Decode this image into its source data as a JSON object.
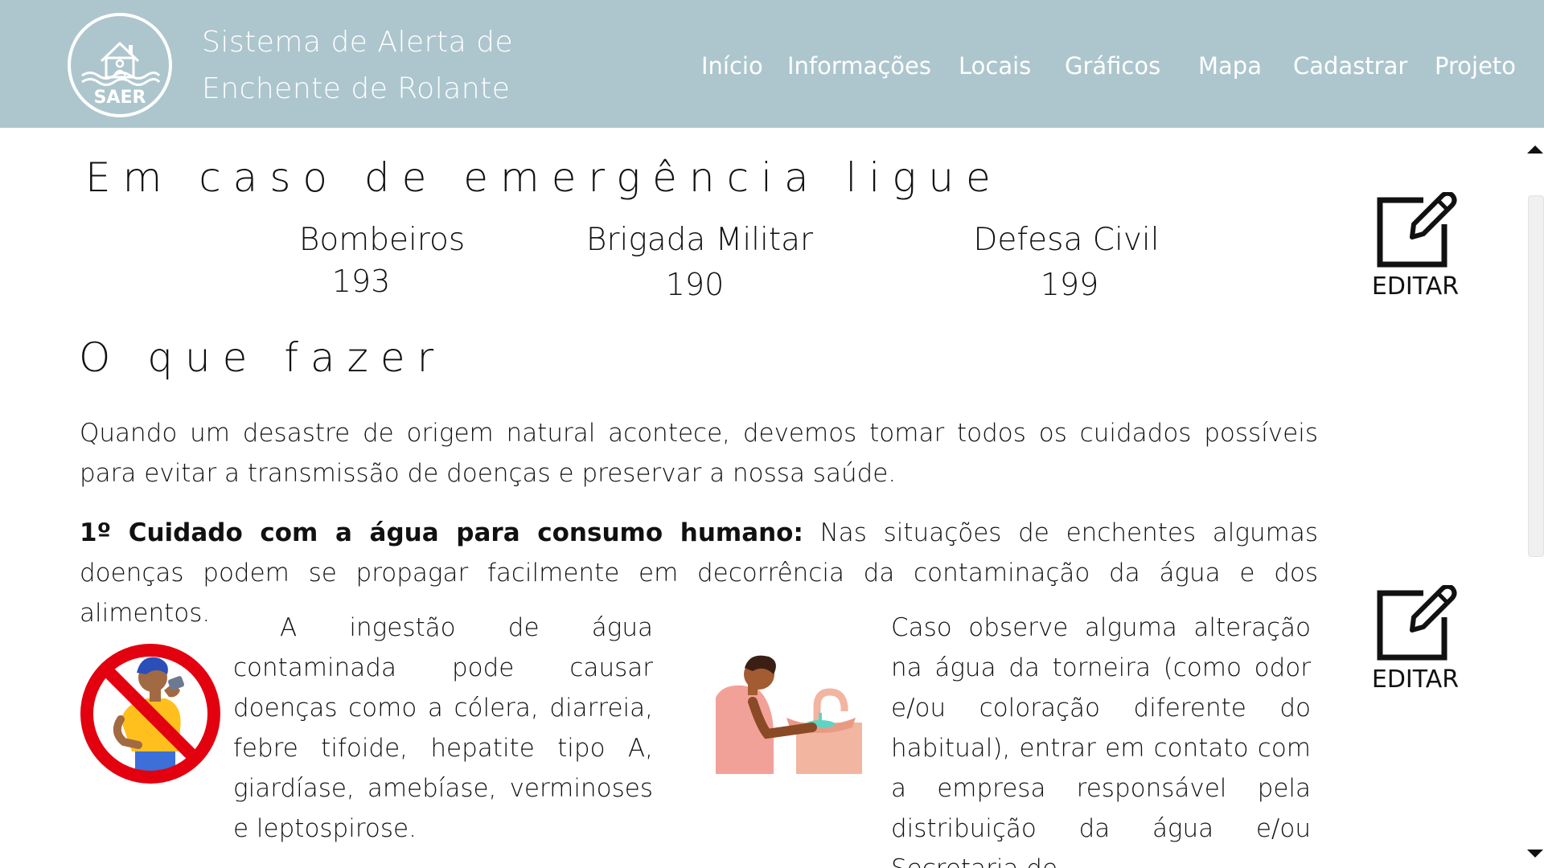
{
  "header": {
    "logo_text": "SAER",
    "title_line1": "Sistema de Alerta de",
    "title_line2": "Enchente de Rolante",
    "nav": [
      {
        "label": "Início"
      },
      {
        "label": "Informações"
      },
      {
        "label": "Locais"
      },
      {
        "label": "Gráficos"
      },
      {
        "label": "Mapa"
      },
      {
        "label": "Cadastrar"
      },
      {
        "label": "Projeto"
      }
    ],
    "bg_color": "#adc6ce"
  },
  "emergency": {
    "heading": "Em caso de emergência ligue",
    "contacts": [
      {
        "name": "Bombeiros",
        "number": "193"
      },
      {
        "name": "Brigada Militar",
        "number": "190"
      },
      {
        "name": "Defesa Civil",
        "number": "199"
      }
    ]
  },
  "what_to_do": {
    "heading": "O que fazer",
    "intro": "Quando um desastre de origem natural acontece, devemos tomar todos os cuidados possíveis para evitar a transmissão de doenças e preservar a nossa saúde.",
    "care1_title": "1º Cuidado com a água para consumo humano:",
    "care1_text": " Nas situações de enchentes algumas doenças podem se propagar facilmente em decorrência da contaminação da água e dos alimentos.",
    "left_column": "A ingestão de água contaminada pode causar doenças como a cólera, diarreia, febre tifoide, hepatite tipo A, giardíase, amebíase, verminoses e leptospirose.",
    "right_column": "Caso observe alguma alteração na água da torneira (como odor e/ou coloração diferente do habitual), entrar em contato com a empresa responsável pela distribuição da água e/ou Secretaria de"
  },
  "edit_buttons": [
    {
      "label": "EDITAR",
      "icon": "edit-icon"
    },
    {
      "label": "EDITAR",
      "icon": "edit-icon"
    }
  ]
}
